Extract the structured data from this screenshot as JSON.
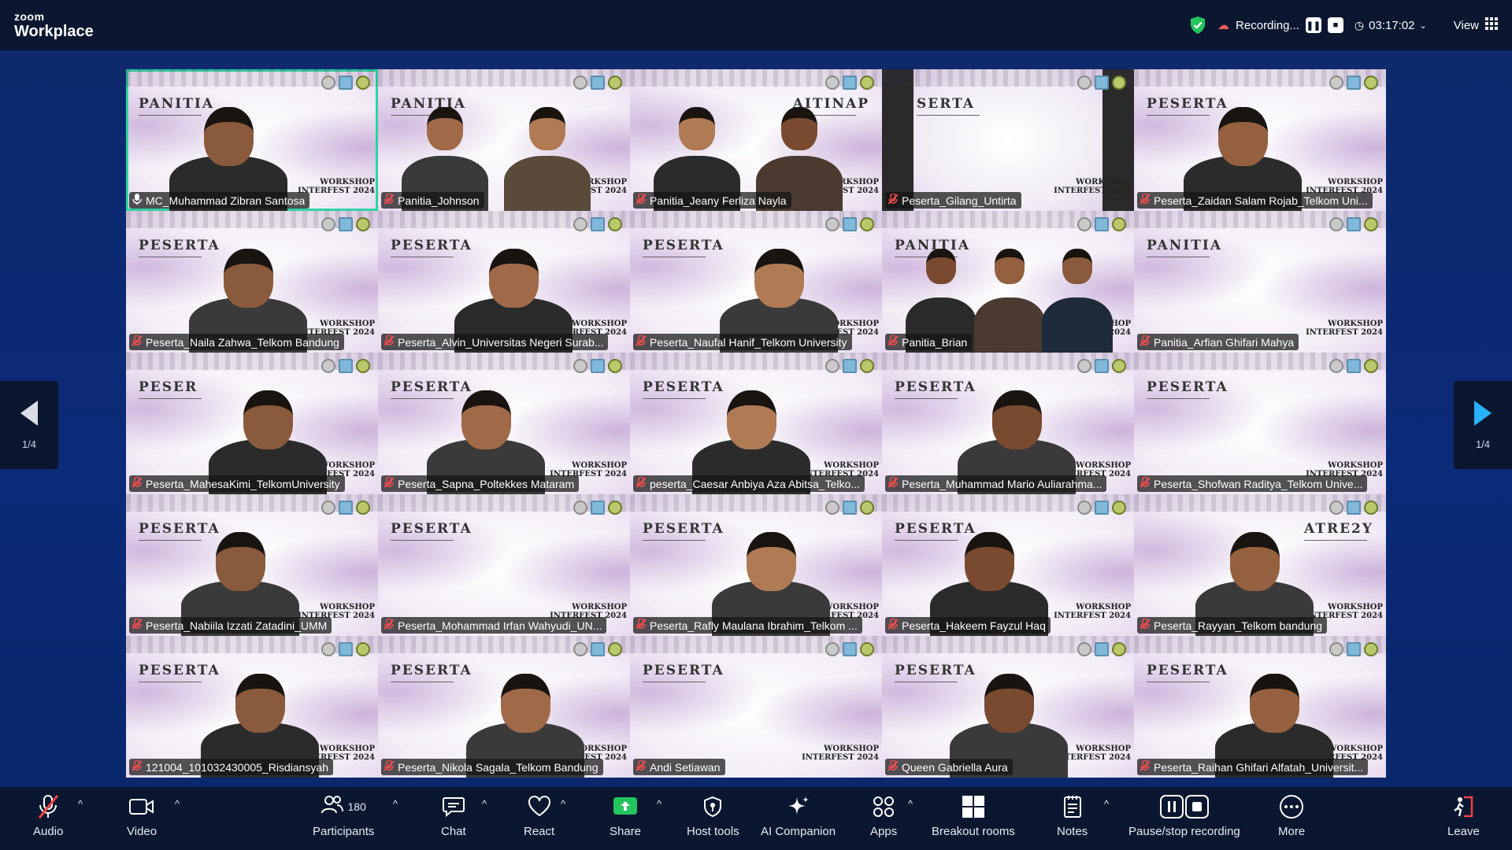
{
  "header": {
    "brand_top": "zoom",
    "brand_bottom": "Workplace",
    "recording_label": "Recording...",
    "timer": "03:17:02",
    "view_label": "View"
  },
  "pager": {
    "left_label": "1/4",
    "right_label": "1/4"
  },
  "tiles": [
    {
      "role": "PANITIA",
      "name": "MC_Muhammad Zibran Santosa",
      "mic": "on",
      "active": true
    },
    {
      "role": "PANITIA",
      "name": "Panitia_Johnson",
      "mic": "muted"
    },
    {
      "role": "AITINAP",
      "name": "Panitia_Jeany Ferliza Nayla",
      "mic": "muted"
    },
    {
      "role": "SERTA",
      "name": "Peserta_Gilang_Untirta",
      "mic": "muted",
      "dark": true
    },
    {
      "role": "PESERTA",
      "name": "Peserta_Zaidan Salam Rojab_Telkom Uni...",
      "mic": "muted"
    },
    {
      "role": "PESERTA",
      "name": "Peserta_Naila Zahwa_Telkom Bandung",
      "mic": "muted"
    },
    {
      "role": "PESERTA",
      "name": "Peserta_Alvin_Universitas Negeri Surab...",
      "mic": "muted"
    },
    {
      "role": "PESERTA",
      "name": "Peserta_Naufal Hanif_Telkom University",
      "mic": "muted"
    },
    {
      "role": "PANITIA",
      "name": "Panitia_Brian",
      "mic": "muted"
    },
    {
      "role": "PANITIA",
      "name": "Panitia_Arfian Ghifari Mahya",
      "mic": "muted"
    },
    {
      "role": "PESER",
      "name": "Peserta_MahesaKimi_TelkomUniversity",
      "mic": "muted"
    },
    {
      "role": "PESERTA",
      "name": "Peserta_Sapna_Poltekkes Mataram",
      "mic": "muted"
    },
    {
      "role": "PESERTA",
      "name": "peserta_Caesar Anbiya Aza Abitsa_Telko...",
      "mic": "muted"
    },
    {
      "role": "PESERTA",
      "name": "Peserta_Muhammad Mario Auliarahma...",
      "mic": "muted"
    },
    {
      "role": "PESERTA",
      "name": "Peserta_Shofwan Raditya_Telkom Unive...",
      "mic": "muted"
    },
    {
      "role": "PESERTA",
      "name": "Peserta_Nabiila Izzati Zatadini_UMM",
      "mic": "muted"
    },
    {
      "role": "PESERTA",
      "name": "Peserta_Mohammad Irfan Wahyudi_UN...",
      "mic": "muted"
    },
    {
      "role": "PESERTA",
      "name": "Peserta_Rafly Maulana Ibrahim_Telkom ...",
      "mic": "muted"
    },
    {
      "role": "PESERTA",
      "name": "Peserta_Hakeem Fayzul Haq",
      "mic": "muted"
    },
    {
      "role": "ATRE2Y",
      "name": "Peserta_Rayyan_Telkom bandung",
      "mic": "muted"
    },
    {
      "role": "PESERTA",
      "name": "121004_101032430005_Risdiansyah",
      "mic": "muted"
    },
    {
      "role": "PESERTA",
      "name": "Peserta_Nikola Sagala_Telkom Bandung",
      "mic": "muted"
    },
    {
      "role": "PESERTA",
      "name": "Andi Setiawan",
      "mic": "muted"
    },
    {
      "role": "PESERTA",
      "name": "Queen Gabriella Aura",
      "mic": "muted"
    },
    {
      "role": "PESERTA",
      "name": "Peserta_Raihan Ghifari Alfatah_Universit...",
      "mic": "muted"
    }
  ],
  "watermark": {
    "line1": "WORKSHOP",
    "line2": "INTERFEST 2024"
  },
  "toolbar": {
    "audio": "Audio",
    "video": "Video",
    "participants": "Participants",
    "participants_count": "180",
    "chat": "Chat",
    "react": "React",
    "share": "Share",
    "host_tools": "Host tools",
    "ai_companion": "AI Companion",
    "apps": "Apps",
    "breakout_rooms": "Breakout rooms",
    "notes": "Notes",
    "pause_stop_recording": "Pause/stop recording",
    "more": "More",
    "leave": "Leave"
  },
  "colors": {
    "accent_green": "#2ed3a4",
    "share_green": "#22c55e",
    "leave_red": "#ef4444",
    "pager_arrow_blue": "#27b1ff"
  }
}
